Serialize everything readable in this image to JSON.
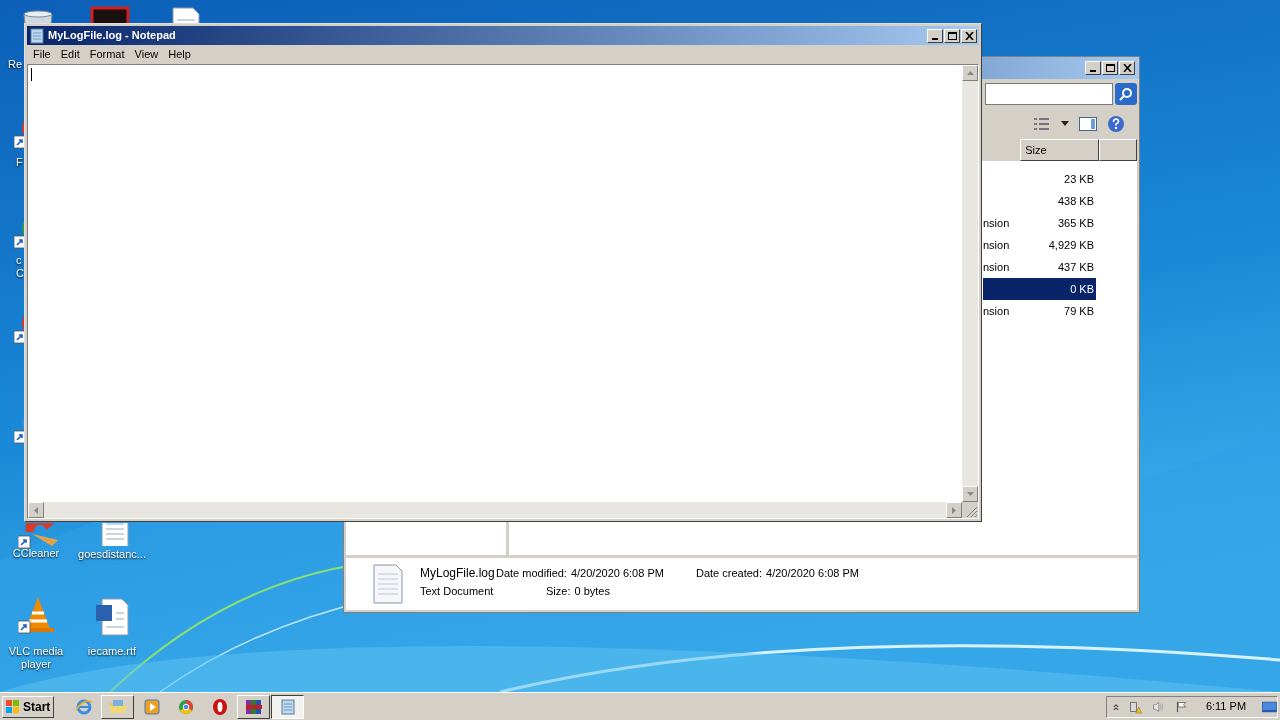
{
  "desktop": {
    "icons": [
      {
        "kind": "recycle",
        "lines": [
          "Re"
        ]
      },
      {
        "kind": "counter"
      },
      {
        "kind": "doc"
      },
      {
        "kind": "app-red",
        "lines": [
          "F"
        ]
      },
      {
        "kind": "browser",
        "lines": [
          "c",
          "C"
        ]
      },
      {
        "kind": "app-red"
      },
      {
        "kind": "app-blue"
      },
      {
        "kind": "cleaner",
        "lines": [
          "CCleaner"
        ]
      },
      {
        "kind": "doc",
        "lines": [
          "goesdistanc..."
        ]
      },
      {
        "kind": "cone",
        "lines": [
          "VLC media player"
        ]
      },
      {
        "kind": "word",
        "lines": [
          "iecame.rtf"
        ]
      }
    ]
  },
  "explorer": {
    "columns": [
      {
        "label": "Size"
      }
    ],
    "rows": [
      {
        "size": "23 KB",
        "selected": false
      },
      {
        "size": "438 KB",
        "selected": false
      },
      {
        "type": "nsion",
        "size": "365 KB",
        "selected": false
      },
      {
        "type": "nsion",
        "size": "4,929 KB",
        "selected": false
      },
      {
        "type": "nsion",
        "size": "437 KB",
        "selected": false
      },
      {
        "size": "0 KB",
        "selected": true
      },
      {
        "type": "nsion",
        "size": "79 KB",
        "selected": false
      }
    ],
    "details": {
      "name": "MyLogFile.log",
      "type": "Text Document",
      "fields": [
        {
          "label": "Date modified:",
          "value": "4/20/2020 6:08 PM"
        },
        {
          "label": "Date created:",
          "value": "4/20/2020 6:08 PM"
        },
        {
          "label": "Size:",
          "value": "0 bytes"
        }
      ]
    }
  },
  "notepad": {
    "title": "MyLogFile.log - Notepad",
    "menu": [
      "File",
      "Edit",
      "Format",
      "View",
      "Help"
    ]
  },
  "taskbar": {
    "start": "Start",
    "apps": [
      {
        "kind": "ie",
        "open": false,
        "selected": false
      },
      {
        "kind": "folder",
        "open": true,
        "selected": false
      },
      {
        "kind": "player",
        "open": false,
        "selected": false
      },
      {
        "kind": "browser",
        "open": false,
        "selected": false
      },
      {
        "kind": "opera",
        "open": false,
        "selected": false
      },
      {
        "kind": "archive",
        "open": true,
        "selected": false
      },
      {
        "kind": "notepad",
        "open": true,
        "selected": true
      }
    ],
    "clock": "6:11 PM"
  }
}
